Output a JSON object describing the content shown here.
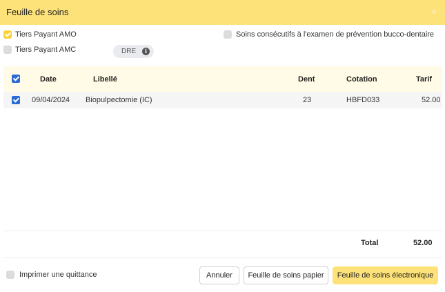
{
  "dialog": {
    "title": "Feuille de soins",
    "close_icon": "×"
  },
  "options": {
    "tiers_payant_amo": {
      "label": "Tiers Payant AMO",
      "checked": true
    },
    "tiers_payant_amc": {
      "label": "Tiers Payant AMC",
      "checked": false
    },
    "soins_consecutifs": {
      "label": "Soins consécutifs à l'examen de prévention bucco-dentaire",
      "checked": false
    },
    "dre": {
      "label": "DRE",
      "info_icon": "i"
    }
  },
  "table": {
    "headers": {
      "date": "Date",
      "libelle": "Libellé",
      "dent": "Dent",
      "cotation": "Cotation",
      "tarif": "Tarif"
    },
    "rows": [
      {
        "checked": true,
        "date": "09/04/2024",
        "libelle": "Biopulpectomie (IC)",
        "dent": "23",
        "cotation": "HBFD033",
        "tarif": "52.00"
      }
    ],
    "total_label": "Total",
    "total_value": "52.00"
  },
  "footer": {
    "print_receipt": {
      "label": "Imprimer une quittance",
      "checked": false
    },
    "cancel_label": "Annuler",
    "paper_label": "Feuille de soins papier",
    "electronic_label": "Feuille de soins électronique"
  },
  "colors": {
    "header_bg": "#fde27a",
    "accent_yellow": "#fbd13b",
    "checkbox_blue": "#2a6bd6"
  }
}
